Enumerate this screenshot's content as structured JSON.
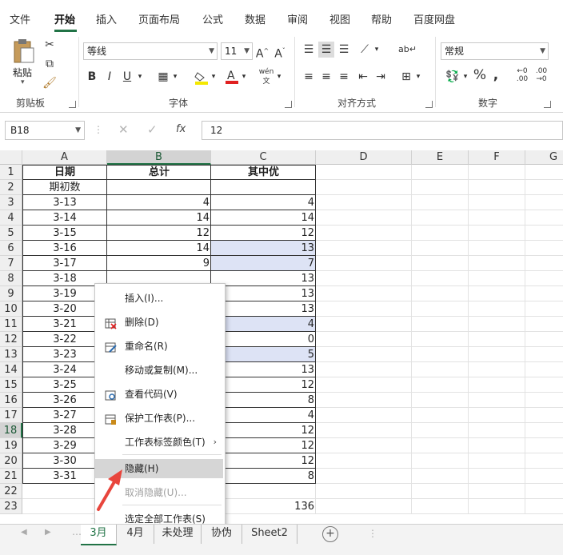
{
  "menu": {
    "tabs": [
      "文件",
      "开始",
      "插入",
      "页面布局",
      "公式",
      "数据",
      "审阅",
      "视图",
      "帮助",
      "百度网盘"
    ],
    "active": "开始"
  },
  "ribbon": {
    "clipboard": {
      "paste": "粘贴",
      "label": "剪贴板"
    },
    "font": {
      "name": "等线",
      "size": "11",
      "label": "字体"
    },
    "alignment": {
      "label": "对齐方式"
    },
    "number": {
      "format": "常规",
      "label": "数字"
    }
  },
  "formula_bar": {
    "name_box": "B18",
    "fx": "fx",
    "value": "12"
  },
  "columns": [
    "A",
    "B",
    "C",
    "D",
    "E",
    "F",
    "G"
  ],
  "rows": [
    {
      "n": "1",
      "a": "日期",
      "b": "总计",
      "c": "其中优"
    },
    {
      "n": "2",
      "a": "期初数",
      "b": "",
      "c": ""
    },
    {
      "n": "3",
      "a": "3-13",
      "b": "4",
      "c": "4"
    },
    {
      "n": "4",
      "a": "3-14",
      "b": "14",
      "c": "14"
    },
    {
      "n": "5",
      "a": "3-15",
      "b": "12",
      "c": "12"
    },
    {
      "n": "6",
      "a": "3-16",
      "b": "14",
      "c": "13"
    },
    {
      "n": "7",
      "a": "3-17",
      "b": "9",
      "c": "7"
    },
    {
      "n": "8",
      "a": "3-18",
      "b": "",
      "c": "13"
    },
    {
      "n": "9",
      "a": "3-19",
      "b": "",
      "c": "13"
    },
    {
      "n": "10",
      "a": "3-20",
      "b": "",
      "c": "13"
    },
    {
      "n": "11",
      "a": "3-21",
      "b": "",
      "c": "4"
    },
    {
      "n": "12",
      "a": "3-22",
      "b": "",
      "c": "0"
    },
    {
      "n": "13",
      "a": "3-23",
      "b": "",
      "c": "5"
    },
    {
      "n": "14",
      "a": "3-24",
      "b": "",
      "c": "13"
    },
    {
      "n": "15",
      "a": "3-25",
      "b": "",
      "c": "12"
    },
    {
      "n": "16",
      "a": "3-26",
      "b": "",
      "c": "8"
    },
    {
      "n": "17",
      "a": "3-27",
      "b": "",
      "c": "4"
    },
    {
      "n": "18",
      "a": "3-28",
      "b": "",
      "c": "12"
    },
    {
      "n": "19",
      "a": "3-29",
      "b": "",
      "c": "12"
    },
    {
      "n": "20",
      "a": "3-30",
      "b": "",
      "c": "12"
    },
    {
      "n": "21",
      "a": "3-31",
      "b": "",
      "c": "8"
    },
    {
      "n": "22",
      "a": "",
      "b": "",
      "c": ""
    },
    {
      "n": "23",
      "a": "",
      "b": "",
      "c": "136"
    }
  ],
  "context_menu": {
    "items": [
      {
        "label": "插入(I)...",
        "icon": ""
      },
      {
        "label": "删除(D)",
        "icon": "delete-sheet-icon"
      },
      {
        "label": "重命名(R)",
        "icon": "rename-icon"
      },
      {
        "label": "移动或复制(M)...",
        "icon": ""
      },
      {
        "label": "查看代码(V)",
        "icon": "view-code-icon"
      },
      {
        "label": "保护工作表(P)...",
        "icon": "protect-sheet-icon"
      },
      {
        "label": "工作表标签颜色(T)",
        "icon": "",
        "submenu": true
      },
      {
        "label": "隐藏(H)",
        "icon": "",
        "hover": true
      },
      {
        "label": "取消隐藏(U)...",
        "icon": "",
        "disabled": true
      },
      {
        "label": "选定全部工作表(S)",
        "icon": ""
      }
    ]
  },
  "sheet_tabs": {
    "tabs": [
      "3月",
      "4月",
      "未处理",
      "协伪",
      "Sheet2"
    ],
    "active": "3月"
  },
  "colors": {
    "accent": "#217346",
    "highlight": "#dde3f5",
    "arrow": "#e8453c"
  }
}
